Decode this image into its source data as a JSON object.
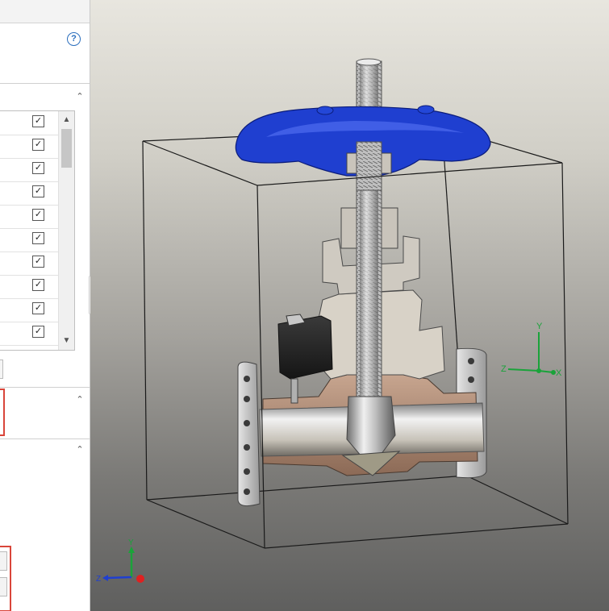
{
  "panel": {
    "help_glyph": "?",
    "list_rows": [
      true,
      true,
      true,
      true,
      true,
      true,
      true,
      true,
      true,
      true
    ],
    "checkmark_glyph": "✓",
    "collapse_glyph": "⌃"
  },
  "viewport": {
    "model_color": "#1f3fd0",
    "axis_labels": {
      "x": "X",
      "y": "Y",
      "z": "Z"
    },
    "triad_labels": {
      "y": "Y",
      "z": "Z"
    }
  }
}
